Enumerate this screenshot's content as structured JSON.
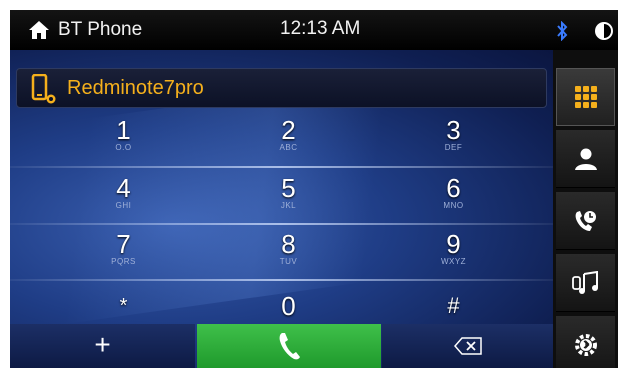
{
  "status_bar": {
    "app_title": "BT Phone",
    "time": "12:13 AM",
    "icons": [
      "home-icon",
      "bluetooth-icon",
      "brightness-icon"
    ]
  },
  "device": {
    "name": "Redminote7pro",
    "icon": "phone-icon",
    "name_color": "#f5b01c"
  },
  "keypad": {
    "keys": [
      {
        "digit": "1",
        "letters": "O.O"
      },
      {
        "digit": "2",
        "letters": "ABC"
      },
      {
        "digit": "3",
        "letters": "DEF"
      },
      {
        "digit": "4",
        "letters": "GHI"
      },
      {
        "digit": "5",
        "letters": "JKL"
      },
      {
        "digit": "6",
        "letters": "MNO"
      },
      {
        "digit": "7",
        "letters": "PQRS"
      },
      {
        "digit": "8",
        "letters": "TUV"
      },
      {
        "digit": "9",
        "letters": "WXYZ"
      },
      {
        "digit": "*",
        "letters": ""
      },
      {
        "digit": "0",
        "letters": ""
      },
      {
        "digit": "#",
        "letters": ""
      }
    ],
    "plus": "+",
    "call_icon": "call-icon",
    "backspace_icon": "backspace-icon",
    "call_color": "#2fae3a"
  },
  "sidebar": {
    "items": [
      {
        "icon": "dialpad-icon",
        "active": true,
        "color": "#f5b01c"
      },
      {
        "icon": "contacts-icon",
        "active": false
      },
      {
        "icon": "call-history-icon",
        "active": false
      },
      {
        "icon": "bt-music-icon",
        "active": false
      },
      {
        "icon": "bt-settings-icon",
        "active": false
      }
    ]
  }
}
